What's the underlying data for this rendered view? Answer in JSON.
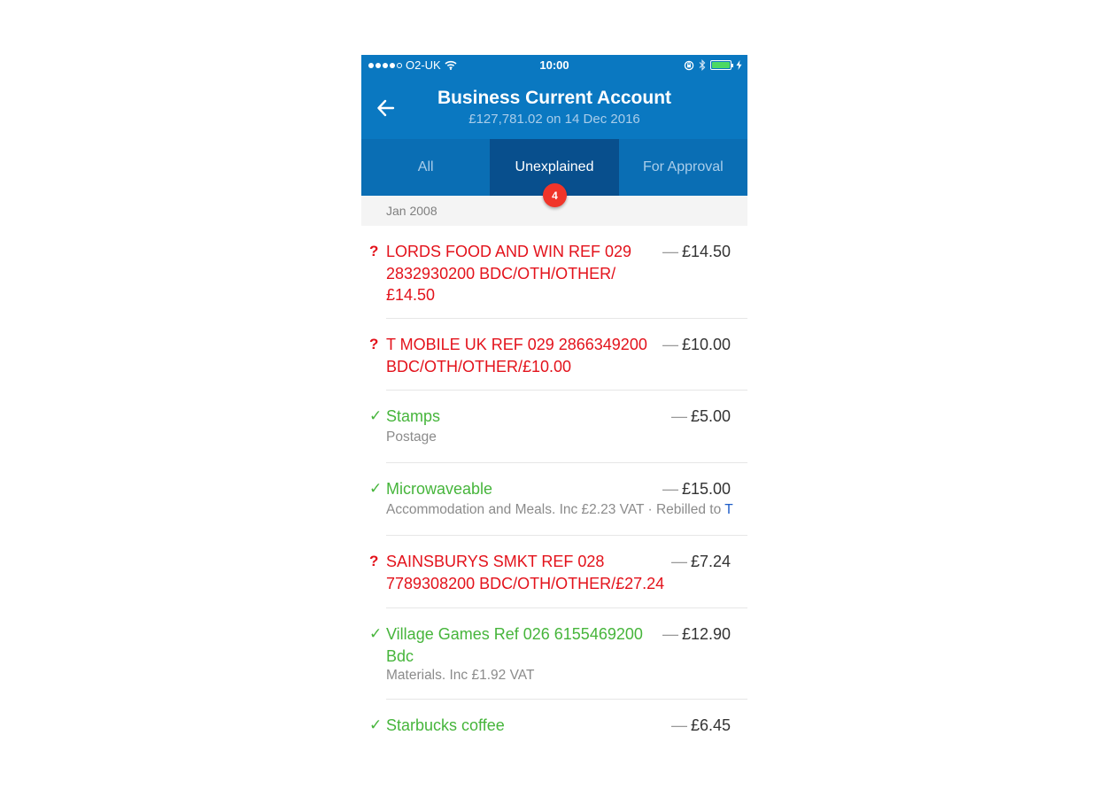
{
  "status_bar": {
    "carrier": "O2-UK",
    "time": "10:00"
  },
  "header": {
    "title": "Business Current Account",
    "subtitle": "£127,781.02  on 14 Dec 2016"
  },
  "tabs": [
    {
      "label": "All"
    },
    {
      "label": "Unexplained"
    },
    {
      "label": "For Approval"
    }
  ],
  "unexplained_badge": "4",
  "section": {
    "label": "Jan 2008"
  },
  "transactions": [
    {
      "status": "?",
      "description": "LORDS FOOD AND WIN REF 029 2832930200 BDC/OTH/OTHER/ £14.50",
      "amount": "£14.50"
    },
    {
      "status": "?",
      "description": "T MOBILE UK REF 029 2866349200 BDC/OTH/OTHER/£10.00",
      "amount": "£10.00"
    },
    {
      "status": "✓",
      "description": "Stamps",
      "detail": "Postage",
      "amount": "£5.00"
    },
    {
      "status": "✓",
      "description": "Microwaveable",
      "detail": "Accommodation and Meals. Inc £2.23 VAT · Rebilled to ",
      "detail_link": "T",
      "amount": "£15.00"
    },
    {
      "status": "?",
      "description": "SAINSBURYS SMKT REF 028 7789308200 BDC/OTH/OTHER/£27.24",
      "amount": "£7.24"
    },
    {
      "status": "✓",
      "description": "Village Games Ref 026 6155469200 Bdc",
      "detail": "Materials. Inc £1.92 VAT",
      "amount": "£12.90"
    },
    {
      "status": "✓",
      "description": "Starbucks coffee",
      "amount": "£6.45"
    }
  ],
  "amount_prefix": "—",
  "colors": {
    "brand_blue": "#0a78c1",
    "tab_bar": "#0a6eb4",
    "tab_active": "#084f8d",
    "unexplained_red": "#e3121b",
    "explained_green": "#46b53b",
    "badge_red": "#f0352a"
  },
  "icons": {
    "back": "arrow-left-icon",
    "wifi": "wifi-icon",
    "rotation_lock": "rotation-lock-icon",
    "bluetooth": "bluetooth-icon",
    "battery": "battery-icon",
    "charging": "charging-bolt-icon"
  }
}
